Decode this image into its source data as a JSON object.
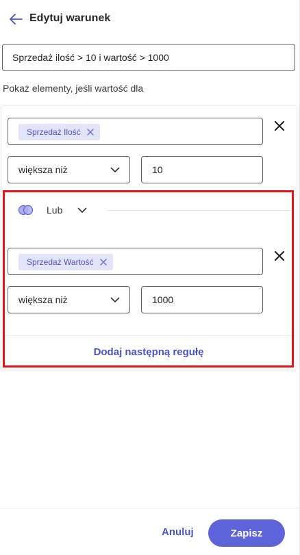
{
  "header": {
    "title": "Edytuj warunek",
    "back_icon": "arrow-left-icon"
  },
  "condition_name": {
    "value": "Sprzedaż ilość > 10 i wartość > 1000"
  },
  "subtitle": "Pokaż elementy, jeśli wartość dla",
  "rules": [
    {
      "field_chip": "Sprzedaż Ilość",
      "operator": "większa niż",
      "value": "10"
    },
    {
      "field_chip": "Sprzedaż Wartość",
      "operator": "większa niż",
      "value": "1000"
    }
  ],
  "logic": {
    "label": "Lub",
    "icon": "venn-circles-icon"
  },
  "add_rule_label": "Dodaj następną regułę",
  "footer": {
    "cancel_label": "Anuluj",
    "save_label": "Zapisz"
  },
  "colors": {
    "accent": "#5d63d9",
    "link": "#4a55c5",
    "chip_bg": "#e3e4fa",
    "highlight": "#e8121a"
  }
}
